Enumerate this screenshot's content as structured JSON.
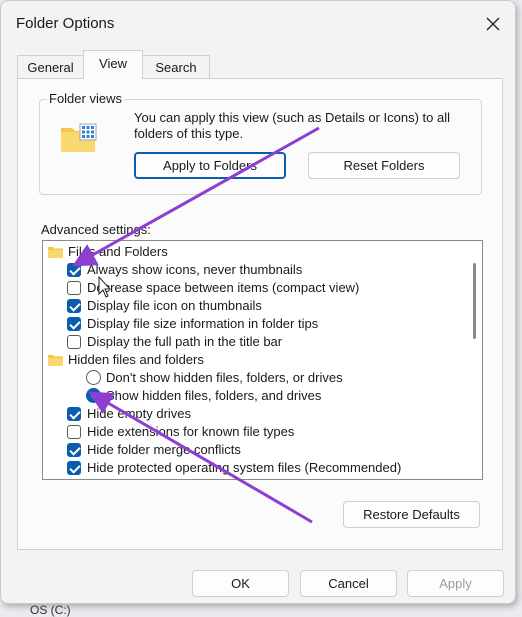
{
  "window": {
    "title": "Folder Options"
  },
  "tabs": [
    {
      "label": "General",
      "active": false
    },
    {
      "label": "View",
      "active": true
    },
    {
      "label": "Search",
      "active": false
    }
  ],
  "folder_views": {
    "label": "Folder views",
    "description": "You can apply this view (such as Details or Icons) to all folders of this type.",
    "apply_button": "Apply to Folders",
    "reset_button": "Reset Folders",
    "icon": "folder-grid-icon"
  },
  "advanced": {
    "label": "Advanced settings:",
    "items": [
      {
        "kind": "folder",
        "text": "Files and Folders"
      },
      {
        "kind": "check",
        "text": "Always show icons, never thumbnails",
        "checked": true
      },
      {
        "kind": "check",
        "text": "Decrease space between items (compact view)",
        "checked": false
      },
      {
        "kind": "check",
        "text": "Display file icon on thumbnails",
        "checked": true
      },
      {
        "kind": "check",
        "text": "Display file size information in folder tips",
        "checked": true
      },
      {
        "kind": "check",
        "text": "Display the full path in the title bar",
        "checked": false
      },
      {
        "kind": "folder",
        "text": "Hidden files and folders"
      },
      {
        "kind": "radio",
        "text": "Don't show hidden files, folders, or drives",
        "checked": false
      },
      {
        "kind": "radio",
        "text": "Show hidden files, folders, and drives",
        "checked": true
      },
      {
        "kind": "check",
        "text": "Hide empty drives",
        "checked": true
      },
      {
        "kind": "check",
        "text": "Hide extensions for known file types",
        "checked": false
      },
      {
        "kind": "check",
        "text": "Hide folder merge conflicts",
        "checked": true
      },
      {
        "kind": "check",
        "text": "Hide protected operating system files (Recommended)",
        "checked": true
      }
    ]
  },
  "restore_button": "Restore Defaults",
  "footer": {
    "ok": "OK",
    "cancel": "Cancel",
    "apply": "Apply"
  },
  "taskbar_fragment": "OS (C:)",
  "colors": {
    "accent": "#0b5cad",
    "annotation": "#8e3fd1"
  }
}
